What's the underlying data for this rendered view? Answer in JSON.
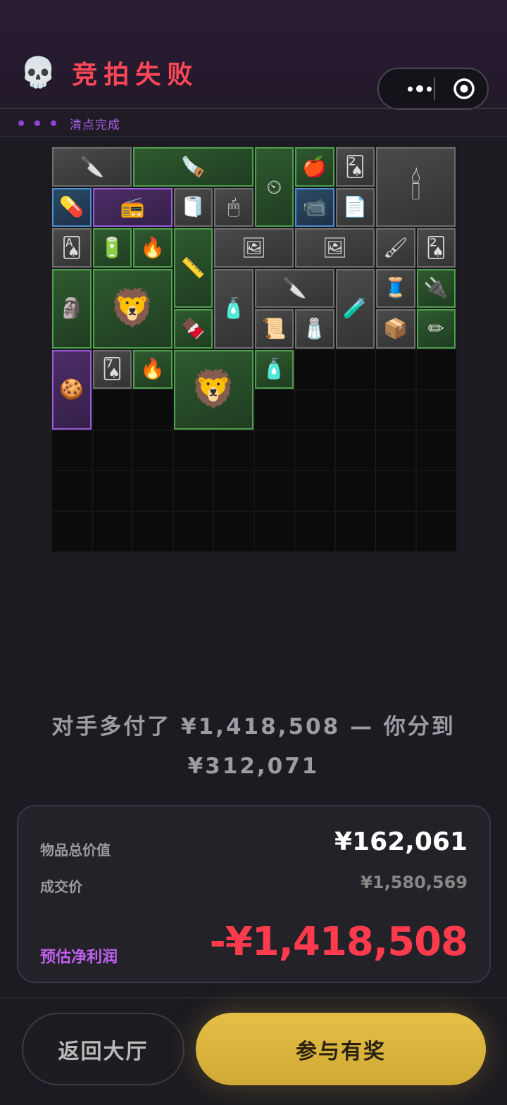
{
  "header": {
    "skull_icon": "💀",
    "title": "竞拍失败",
    "status_text": "清点完成"
  },
  "grid_items": [
    {
      "icon": "🔪",
      "color": "gray",
      "name": "utility-knife"
    },
    {
      "icon": "🪚",
      "color": "green",
      "name": "hand-saw"
    },
    {
      "icon": "⏲",
      "color": "green",
      "name": "pressure-gauge"
    },
    {
      "icon": "🍎",
      "color": "green",
      "name": "apple"
    },
    {
      "icon": "🂢",
      "color": "gray",
      "name": "playing-card"
    },
    {
      "icon": "🕯",
      "color": "gray",
      "name": "candle-box"
    },
    {
      "icon": "💊",
      "color": "blue",
      "name": "pill-bottle"
    },
    {
      "icon": "📻",
      "color": "purple",
      "name": "boombox"
    },
    {
      "icon": "🧻",
      "color": "gray",
      "name": "tape-roll"
    },
    {
      "icon": "🖱",
      "color": "gray",
      "name": "computer-mouse"
    },
    {
      "icon": "📹",
      "color": "blue",
      "name": "security-camera"
    },
    {
      "icon": "📄",
      "color": "gray",
      "name": "documents"
    },
    {
      "icon": "🂡",
      "color": "gray",
      "name": "playing-card"
    },
    {
      "icon": "🔋",
      "color": "green",
      "name": "battery"
    },
    {
      "icon": "🔥",
      "color": "green",
      "name": "lighter"
    },
    {
      "icon": "📏",
      "color": "green",
      "name": "level-tool"
    },
    {
      "icon": "🖼",
      "color": "gray",
      "name": "old-photo"
    },
    {
      "icon": "🖼",
      "color": "gray",
      "name": "old-photo"
    },
    {
      "icon": "🖌",
      "color": "gray",
      "name": "paint-brush"
    },
    {
      "icon": "🂢",
      "color": "gray",
      "name": "playing-card"
    },
    {
      "icon": "🗿",
      "color": "green",
      "name": "wood-statue"
    },
    {
      "icon": "🦁",
      "color": "green",
      "name": "sphinx-statue"
    },
    {
      "icon": "🧴",
      "color": "gray",
      "name": "toothpaste"
    },
    {
      "icon": "🔪",
      "color": "gray",
      "name": "utility-knife"
    },
    {
      "icon": "🧪",
      "color": "gray",
      "name": "ink-bottle"
    },
    {
      "icon": "🧵",
      "color": "gray",
      "name": "rope"
    },
    {
      "icon": "🔌",
      "color": "green",
      "name": "power-strip"
    },
    {
      "icon": "🍫",
      "color": "green",
      "name": "snack-bar"
    },
    {
      "icon": "📜",
      "color": "gray",
      "name": "old-note"
    },
    {
      "icon": "🧂",
      "color": "gray",
      "name": "pepper-grinder"
    },
    {
      "icon": "📦",
      "color": "gray",
      "name": "small-box"
    },
    {
      "icon": "✏",
      "color": "green",
      "name": "tweezers"
    },
    {
      "icon": "🍪",
      "color": "purple",
      "name": "gingerbread-man"
    },
    {
      "icon": "🂧",
      "color": "gray",
      "name": "playing-card"
    },
    {
      "icon": "🔥",
      "color": "green",
      "name": "lighter"
    },
    {
      "icon": "🦁",
      "color": "green",
      "name": "sphinx-statue"
    },
    {
      "icon": "🧴",
      "color": "green",
      "name": "glue-bottle"
    }
  ],
  "result": {
    "outbid_line1": "对手多付了 ¥1,418,508 — 你分到",
    "outbid_line2": "¥312,071",
    "total_value_label": "物品总价值",
    "total_value": "¥162,061",
    "deal_price_label": "成交价",
    "deal_price": "¥1,580,569",
    "profit_label": "预估净利润",
    "profit_value": "-¥1,418,508"
  },
  "buttons": {
    "back_label": "返回大厅",
    "join_label": "参与有奖"
  },
  "colors": {
    "title_red": "#ff4757",
    "profit_red": "#ff3b4d",
    "status_purple": "#a45ee8",
    "join_gold": "#e5bf45"
  }
}
